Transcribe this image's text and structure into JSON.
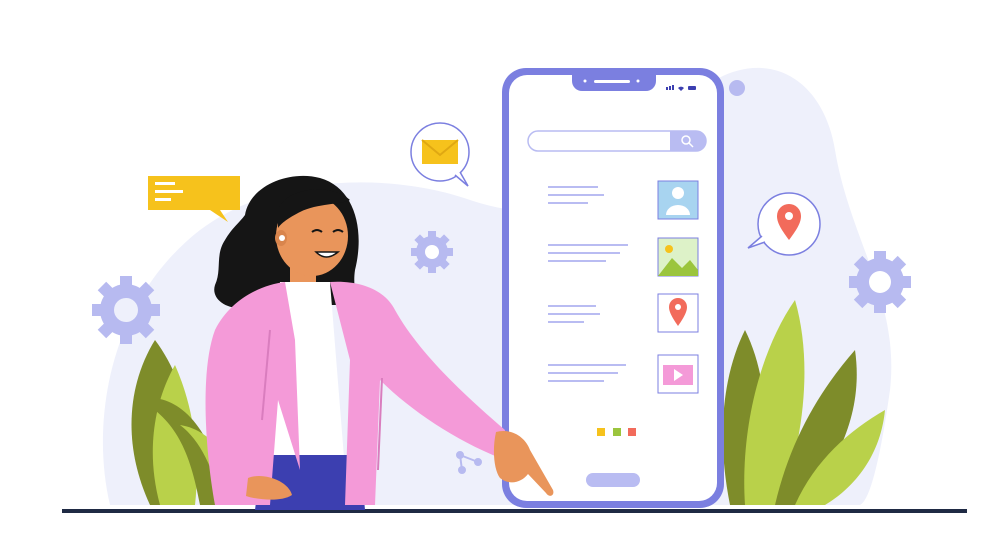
{
  "illustration": {
    "subject": "woman-pointing-at-smartphone",
    "colors": {
      "background_blob": "#EEF0FB",
      "phone_frame": "#7B7FE0",
      "phone_screen": "#FFFFFF",
      "search_bar": "#B9BCF2",
      "jacket": "#F49AD8",
      "shirt": "#FFFFFF",
      "pants": "#3C3FB0",
      "skin": "#E9955B",
      "hair": "#151515",
      "plant_dark": "#7E8C2A",
      "plant_light": "#B9D14A",
      "chat_bubble": "#F6C21C",
      "gear": "#B7BAF0",
      "ground_line": "#1F2A44"
    },
    "phone": {
      "list_icons": [
        "user-icon",
        "image-icon",
        "location-pin-icon",
        "video-icon"
      ],
      "pagination_dot_colors": [
        "#F6C21C",
        "#9BC53D",
        "#F26B5B"
      ]
    },
    "floating_icons": [
      "chat-bubble-icon",
      "envelope-icon",
      "location-pin-icon",
      "gear-icon",
      "gear-icon",
      "gear-icon",
      "share-icon"
    ]
  }
}
